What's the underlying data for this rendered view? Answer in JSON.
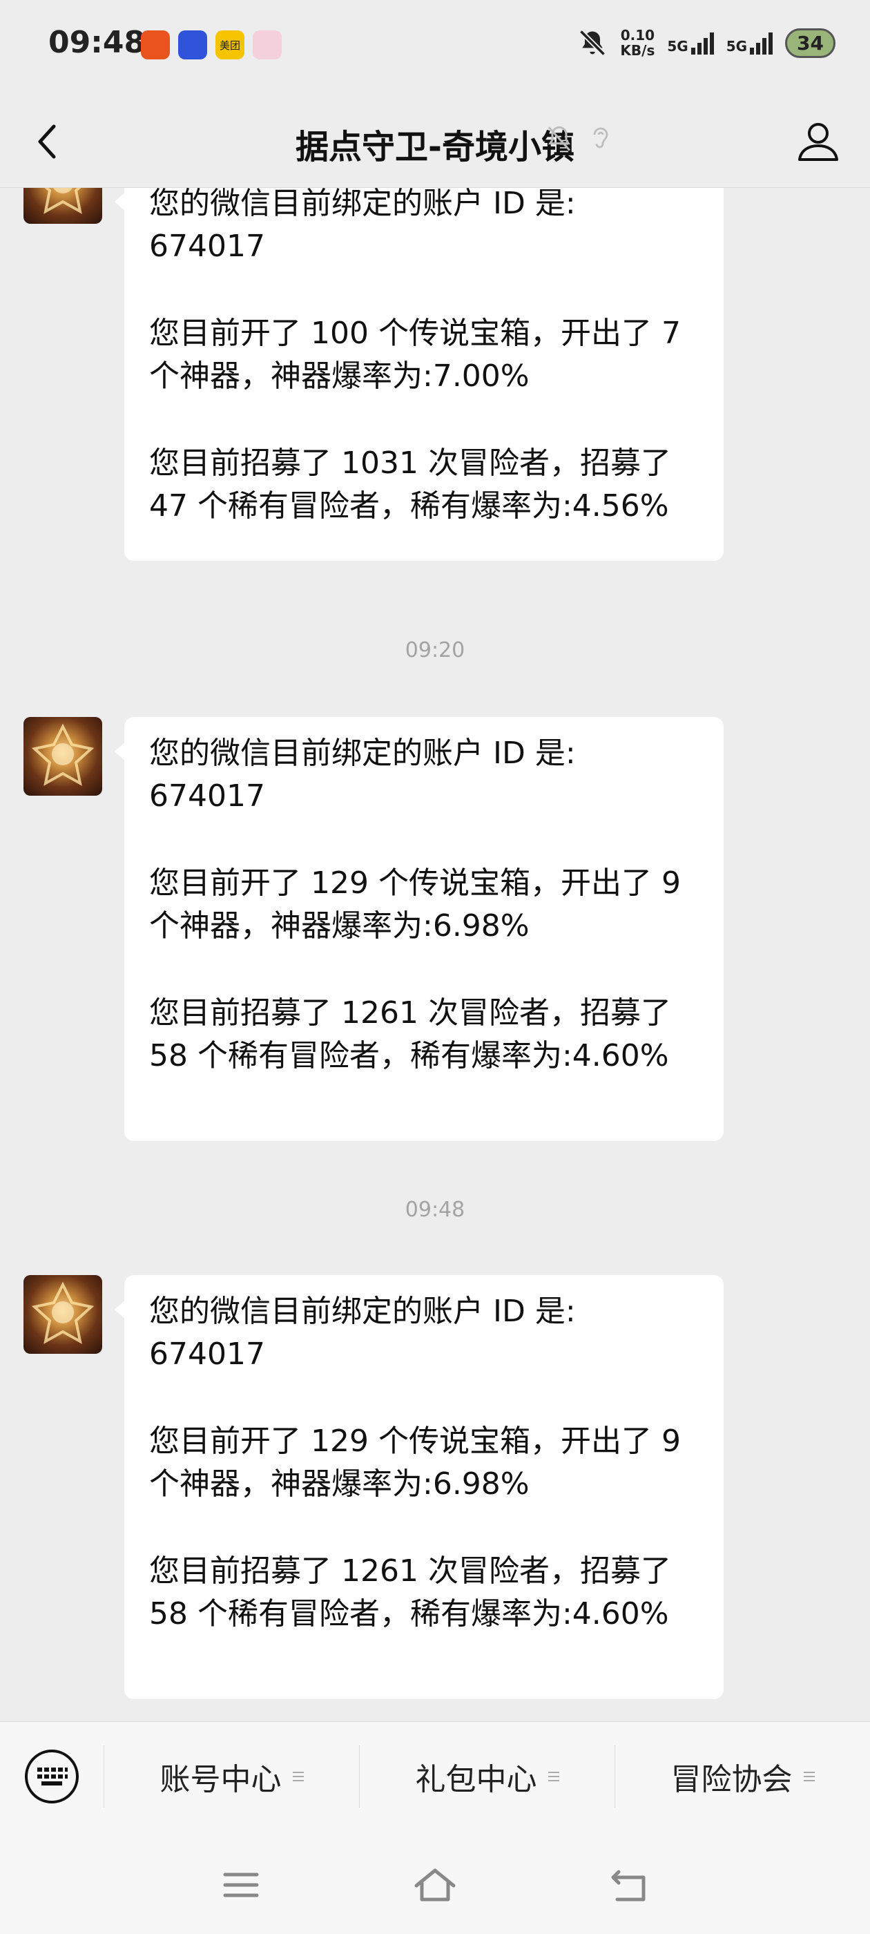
{
  "status_bar": {
    "time": "09:48",
    "app_icons": [
      {
        "name": "app-icon-1",
        "color": "#e8541c",
        "label": ""
      },
      {
        "name": "app-icon-2",
        "color": "#2f53d9",
        "label": ""
      },
      {
        "name": "app-icon-meituan",
        "color": "#f5c300",
        "label": "美团"
      },
      {
        "name": "app-icon-4",
        "color": "#f4d0dc",
        "label": ""
      }
    ],
    "net_speed_value": "0.10",
    "net_speed_unit": "KB/s",
    "network_1": "5G",
    "network_2": "5G",
    "battery": "34"
  },
  "header": {
    "title": "据点守卫-奇境小镇"
  },
  "chat": {
    "messages": [
      {
        "lines": [
          "您的微信目前绑定的账户 ID 是:",
          "674017",
          "",
          "您目前开了 100 个传说宝箱，开出了 7",
          "个神器，神器爆率为:7.00%",
          "",
          "您目前招募了 1031 次冒险者，招募了",
          "47 个稀有冒险者，稀有爆率为:4.56%"
        ]
      },
      {
        "time": "09:20",
        "lines": [
          "您的微信目前绑定的账户 ID 是:",
          "674017",
          "",
          "您目前开了 129 个传说宝箱，开出了 9",
          "个神器，神器爆率为:6.98%",
          "",
          "您目前招募了 1261 次冒险者，招募了",
          "58 个稀有冒险者，稀有爆率为:4.60%"
        ]
      },
      {
        "time": "09:48",
        "lines": [
          "您的微信目前绑定的账户 ID 是:",
          "674017",
          "",
          "您目前开了 129 个传说宝箱，开出了 9",
          "个神器，神器爆率为:6.98%",
          "",
          "您目前招募了 1261 次冒险者，招募了",
          "58 个稀有冒险者，稀有爆率为:4.60%"
        ]
      }
    ]
  },
  "menu": {
    "items": [
      "账号中心",
      "礼包中心",
      "冒险协会"
    ]
  },
  "colors": {
    "background": "#ededed",
    "bubble": "#ffffff",
    "timestamp": "#a3a3a3"
  }
}
